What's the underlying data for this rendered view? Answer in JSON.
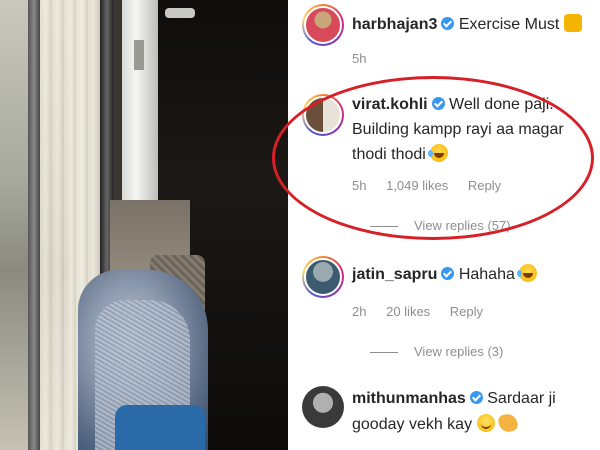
{
  "comments": [
    {
      "username": "harbhajan3",
      "text": "Exercise Must",
      "emoji": "muscle",
      "time": "5h",
      "avatar_colors": [
        "#c9a67a",
        "#d84a5a"
      ]
    },
    {
      "username": "virat.kohli",
      "text_line1": "Well done paji.",
      "text_line2": "Building kampp rayi aa magar",
      "text_line3": "thodi thodi",
      "emoji": "laugh-tear",
      "time": "5h",
      "likes": "1,049 likes",
      "reply": "Reply",
      "view_replies": "View replies (57)",
      "avatar_colors": [
        "#6b4f3a",
        "#e8e2d8"
      ]
    },
    {
      "username": "jatin_sapru",
      "text": "Hahaha",
      "emoji": "laugh-tear",
      "time": "2h",
      "likes": "20 likes",
      "reply": "Reply",
      "view_replies": "View replies (3)",
      "avatar_colors": [
        "#9aa8b0",
        "#3c5a70"
      ]
    },
    {
      "username": "mithunmanhas",
      "text_line1": "Sardaar ji",
      "text_line2": "gooday vekh kay",
      "emojis": [
        "smile",
        "clap"
      ],
      "avatar_colors": [
        "#3a3a3a",
        "#b0b0b0"
      ]
    }
  ],
  "colors": {
    "annotation": "#d61f26",
    "verified": "#3897f0",
    "meta_text": "#8e8e8e",
    "body_text": "#262626"
  }
}
